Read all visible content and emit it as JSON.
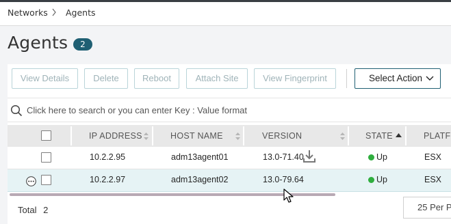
{
  "breadcrumb": {
    "items": [
      "Networks",
      "Agents"
    ]
  },
  "page": {
    "title": "Agents",
    "count": "2"
  },
  "toolbar": {
    "buttons": [
      "View Details",
      "Delete",
      "Reboot",
      "Attach Site",
      "View Fingerprint"
    ],
    "select_action": "Select Action"
  },
  "search": {
    "placeholder": "Click here to search or you can enter Key : Value format"
  },
  "table": {
    "columns": [
      "IP ADDRESS",
      "HOST NAME",
      "VERSION",
      "STATE",
      "PLATFO"
    ],
    "rows": [
      {
        "ip": "10.2.2.95",
        "host": "adm13agent01",
        "version": "13.0-71.40",
        "state": "Up",
        "platform": "ESX"
      },
      {
        "ip": "10.2.2.97",
        "host": "adm13agent02",
        "version": "13.0-79.64",
        "state": "Up",
        "platform": "ESX"
      }
    ]
  },
  "footer": {
    "total_label": "Total",
    "total_value": "2",
    "per_page": "25 Per Page"
  },
  "colors": {
    "accent": "#1f5f73",
    "status_up": "#2fae3e",
    "selected_row": "#e6f3f5"
  }
}
